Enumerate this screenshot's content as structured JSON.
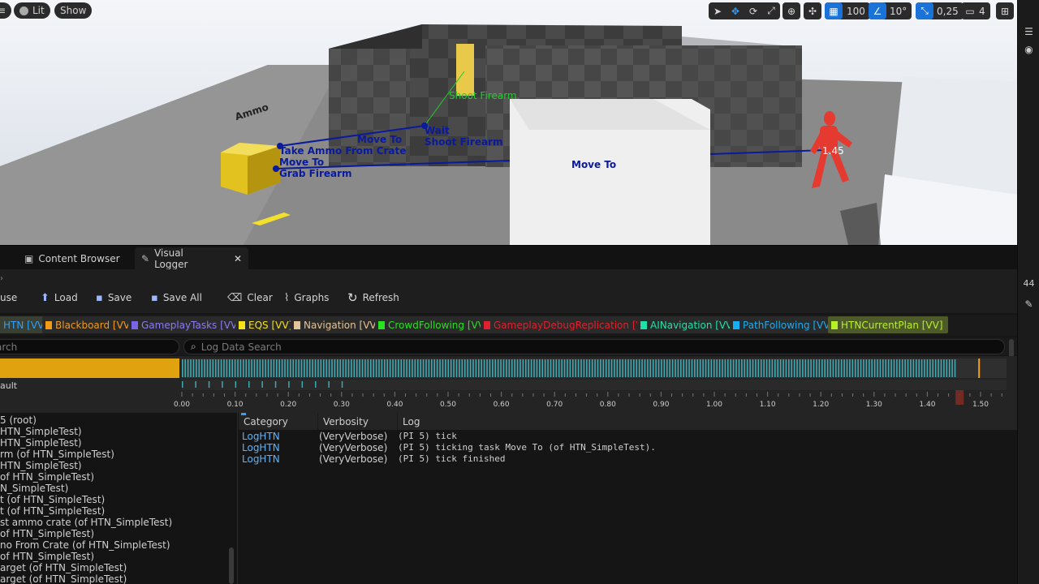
{
  "viewport": {
    "lit_label": "Lit",
    "show_label": "Show",
    "grid_value": "100",
    "angle_value": "10°",
    "scale_value": "0,25",
    "camera_speed": "4",
    "labels": {
      "ammo": "Ammo",
      "shoot_firearm_green": "Shoot Firearm",
      "move_to_1": "Move To",
      "wait": "Wait",
      "shoot_firearm": "Shoot Firearm",
      "take_ammo": "Take Ammo From Crate",
      "move_to_2": "Move To",
      "grab_firearm": "Grab Firearm",
      "move_to_3": "Move To",
      "time_marker": "1.45"
    }
  },
  "right_strip": {
    "number": "44"
  },
  "tabs": [
    {
      "label": "Content Browser",
      "active": false
    },
    {
      "label": "Visual Logger",
      "active": true
    }
  ],
  "toolbar": {
    "pause_label": "use",
    "load_label": "Load",
    "save_label": "Save",
    "save_all_label": "Save All",
    "clear_label": "Clear",
    "graphs_label": "Graphs",
    "refresh_label": "Refresh"
  },
  "categories": [
    {
      "label": "HTN [VV]",
      "color": "#2ea0ff",
      "text_color": "#2ea0ff",
      "highlighted": true
    },
    {
      "label": "Blackboard [VV]",
      "color": "#f29b17",
      "text_color": "#f29b17"
    },
    {
      "label": "GameplayTasks [VV]",
      "color": "#7b64e6",
      "text_color": "#8b7cf0"
    },
    {
      "label": "EQS [VV]",
      "color": "#f4e11a",
      "text_color": "#f4e11a"
    },
    {
      "label": "Navigation [VV]",
      "color": "#e3c59a",
      "text_color": "#e3c59a"
    },
    {
      "label": "CrowdFollowing [VV]",
      "color": "#27e21e",
      "text_color": "#27e21e"
    },
    {
      "label": "GameplayDebugReplication [VV]",
      "color": "#e0202d",
      "text_color": "#e0202d"
    },
    {
      "label": "AINavigation [VV]",
      "color": "#1fe0a8",
      "text_color": "#1fe0a8"
    },
    {
      "label": "PathFollowing [VV]",
      "color": "#16aef2",
      "text_color": "#16aef2"
    },
    {
      "label": "HTNCurrentPlan [VV]",
      "color": "#b5f22a",
      "text_color": "#b5f22a",
      "highlighted": true
    }
  ],
  "search": {
    "left_placeholder": "arch",
    "log_placeholder": "Log Data Search"
  },
  "timeline": {
    "row_label": "ault",
    "ticks": [
      "0.00",
      "0.10",
      "0.20",
      "0.30",
      "0.40",
      "0.50",
      "0.60",
      "0.70",
      "0.80",
      "0.90",
      "1.00",
      "1.10",
      "1.20",
      "1.30",
      "1.40",
      "1.50"
    ],
    "current_time": 1.45
  },
  "tree": [
    "5 (root)",
    "HTN_SimpleTest)",
    "HTN_SimpleTest)",
    "rm (of HTN_SimpleTest)",
    "HTN_SimpleTest)",
    "of HTN_SimpleTest)",
    "N_SimpleTest)",
    "t (of HTN_SimpleTest)",
    "t (of HTN_SimpleTest)",
    "st ammo crate (of HTN_SimpleTest)",
    "of HTN_SimpleTest)",
    "no From Crate (of HTN_SimpleTest)",
    "of HTN_SimpleTest)",
    "arget (of HTN_SimpleTest)",
    "arget (of HTN_SimpleTest)"
  ],
  "log": {
    "headers": {
      "category": "Category",
      "verbosity": "Verbosity",
      "log": "Log"
    },
    "rows": [
      {
        "category": "LogHTN",
        "verbosity": "(VeryVerbose)",
        "log": "(PI 5) tick"
      },
      {
        "category": "LogHTN",
        "verbosity": "(VeryVerbose)",
        "log": "(PI 5) ticking task Move To (of HTN_SimpleTest)."
      },
      {
        "category": "LogHTN",
        "verbosity": "(VeryVerbose)",
        "log": "(PI 5) tick finished"
      }
    ]
  }
}
